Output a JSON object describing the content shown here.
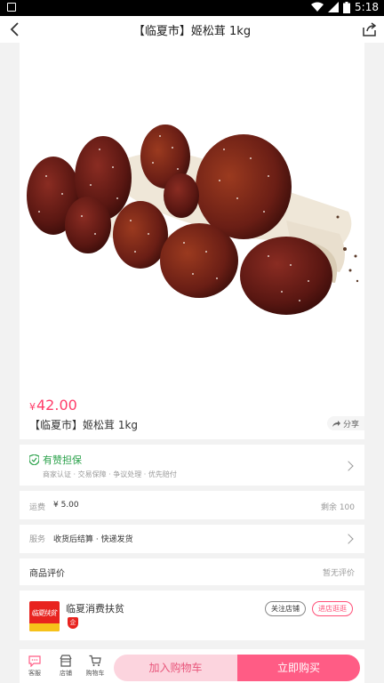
{
  "status_bar": {
    "time": "5:18"
  },
  "header": {
    "title": "【临夏市】姬松茸 1kg"
  },
  "product": {
    "currency": "¥",
    "price": "42.00",
    "name": "【临夏市】姬松茸 1kg",
    "share_label": "分享"
  },
  "guarantee": {
    "title": "有赞担保",
    "subtitle": "商家认证 · 交易保障 · 争议处理 · 优先赔付"
  },
  "shipping": {
    "label": "运费",
    "value": "¥ 5.00",
    "stock": "剩余 100"
  },
  "service": {
    "label": "服务",
    "value": "收货后结算 · 快递发货"
  },
  "review": {
    "title": "商品评价",
    "status": "暂无评价"
  },
  "shop": {
    "name": "临夏消费扶贫",
    "logo_text": "临夏扶贫",
    "badge": "企",
    "follow_label": "关注店铺",
    "enter_label": "进店逛逛"
  },
  "bottom_bar": {
    "service_label": "客服",
    "store_label": "店铺",
    "cart_label": "购物车",
    "add_to_cart_label": "加入购物车",
    "buy_now_label": "立即购买"
  },
  "colors": {
    "accent": "#ff5c85",
    "price": "#ff3c69",
    "guarantee": "#2aa14a"
  }
}
